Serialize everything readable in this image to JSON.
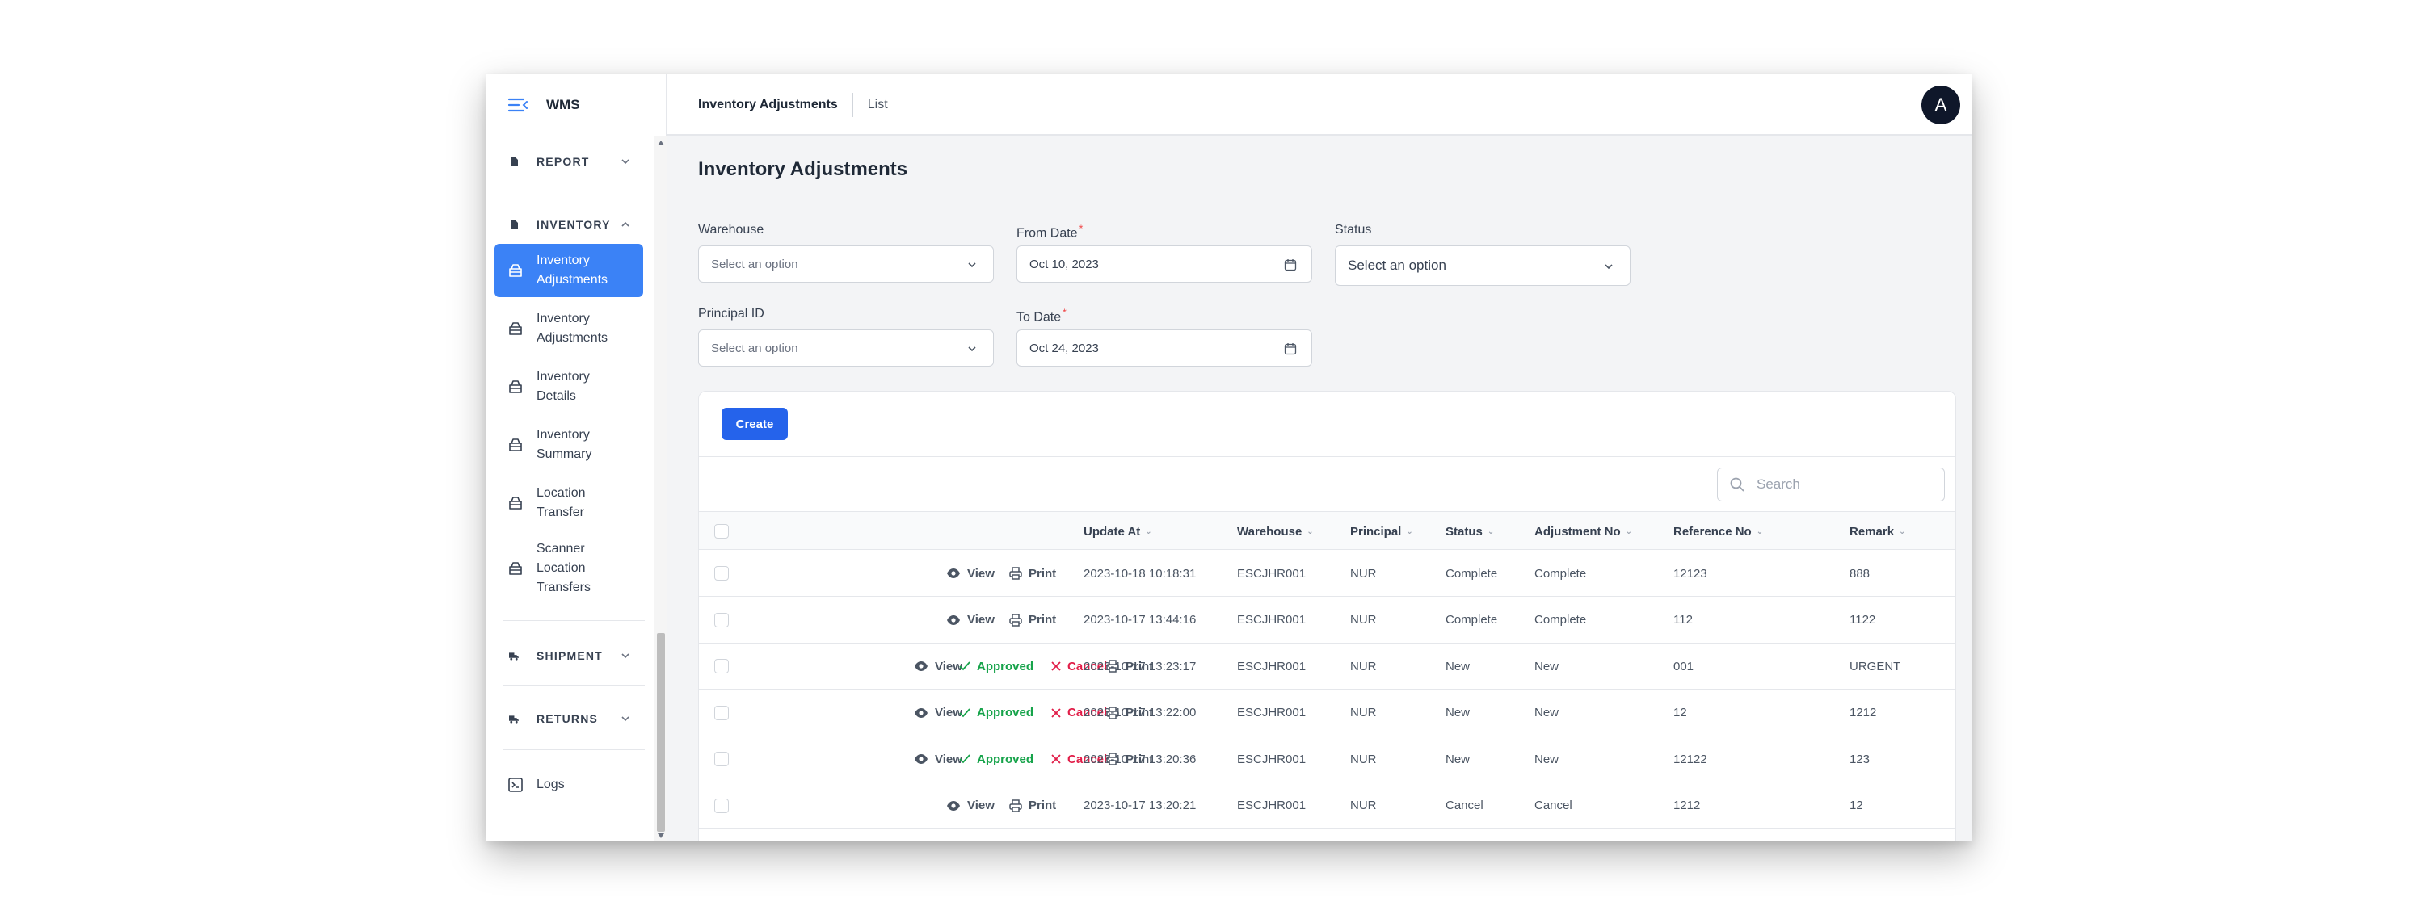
{
  "app": {
    "brand": "WMS",
    "avatar_initial": "A"
  },
  "breadcrumb": {
    "current": "Inventory Adjustments",
    "link": "List"
  },
  "sidebar": {
    "sections": [
      {
        "label": "REPORT",
        "icon": "document-icon",
        "expanded": false
      },
      {
        "label": "INVENTORY",
        "icon": "document-icon",
        "expanded": true
      },
      {
        "label": "SHIPMENT",
        "icon": "truck-icon",
        "expanded": false
      },
      {
        "label": "RETURNS",
        "icon": "truck-icon",
        "expanded": false
      }
    ],
    "items": [
      {
        "label": "Inventory Adjustments",
        "icon": "box-icon",
        "active": true
      },
      {
        "label": "Inventory Adjustments",
        "icon": "box-icon",
        "active": false
      },
      {
        "label": "Inventory Details",
        "icon": "box-icon",
        "active": false
      },
      {
        "label": "Inventory Summary",
        "icon": "box-icon",
        "active": false
      },
      {
        "label": "Location Transfer",
        "icon": "box-icon",
        "active": false
      },
      {
        "label": "Scanner Location Transfers",
        "icon": "box-icon",
        "active": false
      }
    ],
    "logs": {
      "label": "Logs",
      "icon": "terminal-icon"
    }
  },
  "page": {
    "title": "Inventory Adjustments"
  },
  "filters": {
    "warehouse": {
      "label": "Warehouse",
      "placeholder": "Select an option"
    },
    "from_date": {
      "label": "From Date",
      "value": "Oct 10, 2023",
      "required": "*"
    },
    "status": {
      "label": "Status",
      "placeholder": "Select an option"
    },
    "principal": {
      "label": "Principal ID",
      "placeholder": "Select an option"
    },
    "to_date": {
      "label": "To Date",
      "value": "Oct 24, 2023",
      "required": "*"
    }
  },
  "toolbar": {
    "create_label": "Create",
    "search_placeholder": "Search"
  },
  "actions": {
    "view": "View",
    "approved": "Approved",
    "cancel": "Cancel",
    "print": "Print"
  },
  "table": {
    "columns": [
      "Update At",
      "Warehouse",
      "Principal",
      "Status",
      "Adjustment No",
      "Reference No",
      "Remark"
    ],
    "rows": [
      {
        "update_at": "2023-10-18 10:18:31",
        "warehouse": "ESCJHR001",
        "principal": "NUR",
        "status": "Complete",
        "adjustment_no": "Complete",
        "reference_no": "12123",
        "remark": "888",
        "actions": [
          "view",
          "print"
        ]
      },
      {
        "update_at": "2023-10-17 13:44:16",
        "warehouse": "ESCJHR001",
        "principal": "NUR",
        "status": "Complete",
        "adjustment_no": "Complete",
        "reference_no": "112",
        "remark": "1122",
        "actions": [
          "view",
          "print"
        ]
      },
      {
        "update_at": "2023-10-17 13:23:17",
        "warehouse": "ESCJHR001",
        "principal": "NUR",
        "status": "New",
        "adjustment_no": "New",
        "reference_no": "001",
        "remark": "URGENT",
        "actions": [
          "view",
          "approved",
          "cancel",
          "print"
        ]
      },
      {
        "update_at": "2023-10-17 13:22:00",
        "warehouse": "ESCJHR001",
        "principal": "NUR",
        "status": "New",
        "adjustment_no": "New",
        "reference_no": "12",
        "remark": "1212",
        "actions": [
          "view",
          "approved",
          "cancel",
          "print"
        ]
      },
      {
        "update_at": "2023-10-17 13:20:36",
        "warehouse": "ESCJHR001",
        "principal": "NUR",
        "status": "New",
        "adjustment_no": "New",
        "reference_no": "12122",
        "remark": "123",
        "actions": [
          "view",
          "approved",
          "cancel",
          "print"
        ]
      },
      {
        "update_at": "2023-10-17 13:20:21",
        "warehouse": "ESCJHR001",
        "principal": "NUR",
        "status": "Cancel",
        "adjustment_no": "Cancel",
        "reference_no": "1212",
        "remark": "12",
        "actions": [
          "view",
          "print"
        ]
      }
    ]
  },
  "colors": {
    "primary": "#2563eb",
    "active_nav": "#3b82f6",
    "approve": "#16a34a",
    "cancel": "#e11d48",
    "avatar": "#0f172a"
  }
}
